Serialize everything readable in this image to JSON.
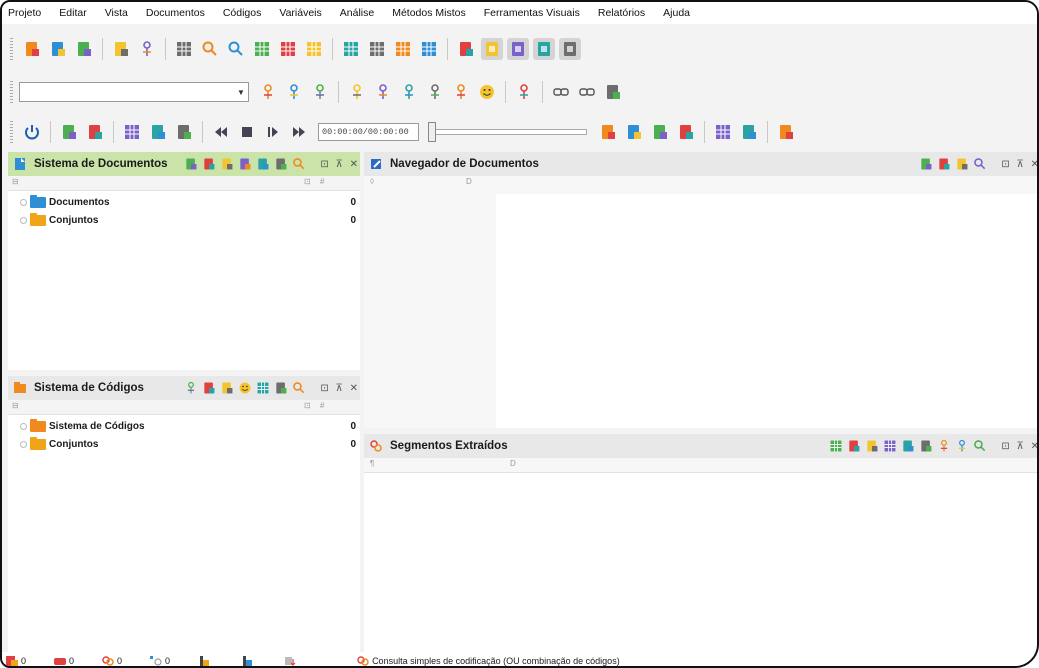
{
  "menu": [
    "Projeto",
    "Editar",
    "Vista",
    "Documentos",
    "Códigos",
    "Variáveis",
    "Análise",
    "Métodos Mistos",
    "Ferramentas Visuais",
    "Relatórios",
    "Ajuda"
  ],
  "toolbar1_icons": [
    "new-project-icon",
    "open-project-icon",
    "import-document-icon",
    "separator",
    "code-document-icon",
    "code-segment-icon",
    "separator",
    "document-table-icon",
    "search-icon",
    "code-search-icon",
    "code-matrix-icon",
    "code-relations-icon",
    "codebook-icon",
    "separator",
    "table-view-icon",
    "table-view-2-icon",
    "retrieval-icon",
    "summary-icon",
    "separator",
    "presentation-icon",
    "document-system-toggle-icon",
    "code-system-toggle-icon",
    "document-browser-toggle-icon",
    "retrieved-segments-toggle-icon"
  ],
  "toolbar2_icons": [
    "code-icon",
    "code-add-icon",
    "code-remove-icon",
    "separator",
    "code-highlight-yellow-icon",
    "code-highlight-red-icon",
    "code-highlight-green-icon",
    "code-highlight-blue-icon",
    "code-highlight-magenta-icon",
    "smiley-icon",
    "separator",
    "in-vivo-code-icon",
    "separator",
    "link-icon",
    "unlink-icon",
    "add-memo-icon"
  ],
  "toolbar3_icons": [
    "power-icon",
    "separator",
    "transcript-icon",
    "timestamp-icon",
    "separator",
    "media-table-icon",
    "media-add-icon",
    "media-person-icon",
    "separator",
    "rewind-icon",
    "stop-icon",
    "play-icon",
    "fast-forward-icon"
  ],
  "toolbar3_right_icons": [
    "pen-icon",
    "scatter-icon",
    "bar-chart-icon",
    "document-icon",
    "separator",
    "grid-icon",
    "color-icon",
    "separator",
    "spellcheck-icon"
  ],
  "combo": {
    "value": ""
  },
  "media": {
    "time": "00:00:00/00:00:00",
    "progress": 0
  },
  "document_system": {
    "title": "Sistema de Documentos",
    "col1": "⊡",
    "col2": "#",
    "items": [
      {
        "label": "Documentos",
        "count": "0",
        "color": "#2e8fd4"
      },
      {
        "label": "Conjuntos",
        "count": "0",
        "color": "#f0a418"
      }
    ]
  },
  "code_system": {
    "title": "Sistema de Códigos",
    "col1": "⊡",
    "col2": "#",
    "items": [
      {
        "label": "Sistema de Códigos",
        "count": "0",
        "color": "#f08a1e"
      },
      {
        "label": "Conjuntos",
        "count": "0",
        "color": "#f0a418"
      }
    ]
  },
  "document_browser": {
    "title": "Navegador de Documentos",
    "col1": "◊",
    "col2": "D"
  },
  "retrieved_segments": {
    "title": "Segmentos Extraídos",
    "col1": "¶",
    "col2": "D"
  },
  "window_controls": "⊡ ⊼ ✕",
  "status": {
    "docs": "0",
    "codes": "0",
    "coded_segments": "0",
    "memos": "0",
    "query": "Consulta simples de codificação (OU combinação de códigos)"
  },
  "colors": {
    "accent_green": "#c9e3a8",
    "header_gray": "#e8e8e8",
    "doc_blue": "#2e8fd4",
    "code_orange": "#f08a1e"
  }
}
